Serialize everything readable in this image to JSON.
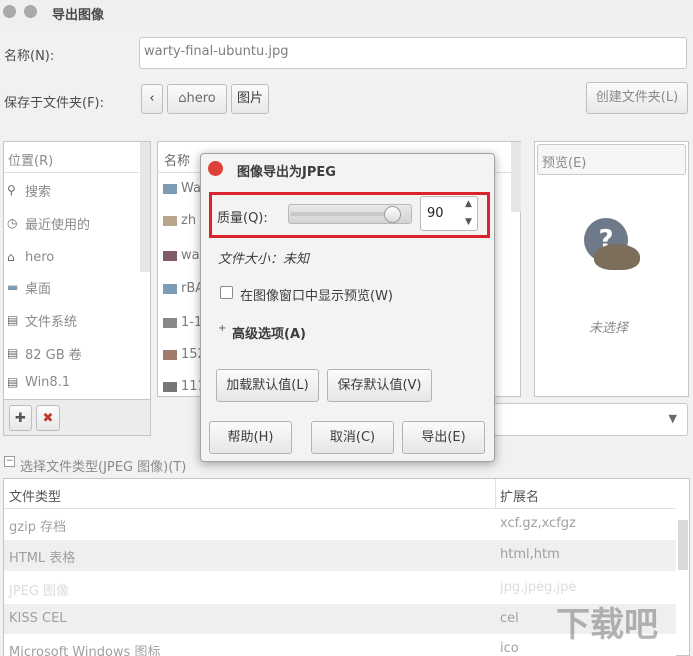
{
  "window": {
    "title": "导出图像"
  },
  "name_row": {
    "label": "名称(N):",
    "value": "warty-final-ubuntu.jpg"
  },
  "folder_row": {
    "label": "保存于文件夹(F):",
    "crumbs": [
      "hero",
      "图片"
    ],
    "create_folder": "创建文件夹(L)"
  },
  "places": {
    "header": "位置(R)",
    "items": [
      "搜索",
      "最近使用的",
      "hero",
      "桌面",
      "文件系统",
      "82 GB 卷",
      "Win8.1"
    ]
  },
  "files": {
    "header_name": "名称",
    "rows": [
      "Wa",
      "zh",
      "wa",
      "rBA",
      "1-1",
      "152",
      "111"
    ]
  },
  "preview": {
    "header": "预览(E)",
    "empty": "未选择"
  },
  "filetype": {
    "toggle": "选择文件类型(JPEG 图像)(T)",
    "col_type": "文件类型",
    "col_ext": "扩展名",
    "rows": [
      {
        "type": "gzip 存档",
        "ext": "xcf.gz,xcfgz"
      },
      {
        "type": "HTML 表格",
        "ext": "html,htm"
      },
      {
        "type": "JPEG 图像",
        "ext": "jpg,jpeg,jpe"
      },
      {
        "type": "KISS CEL",
        "ext": "cel"
      },
      {
        "type": "Microsoft Windows 图标",
        "ext": "ico"
      }
    ]
  },
  "dialog": {
    "title": "图像导出为JPEG",
    "quality_label": "质量(Q):",
    "quality_value": "90",
    "quality_fraction": 0.9,
    "file_size": "文件大小：未知",
    "show_preview": "在图像窗口中显示预览(W)",
    "advanced": "高级选项(A)",
    "load_defaults": "加载默认值(L)",
    "save_defaults": "保存默认值(V)",
    "help": "帮助(H)",
    "cancel": "取消(C)",
    "export": "导出(E)"
  },
  "colors": {
    "highlight_box": "#d9232d",
    "close_button": "#e0403a"
  }
}
